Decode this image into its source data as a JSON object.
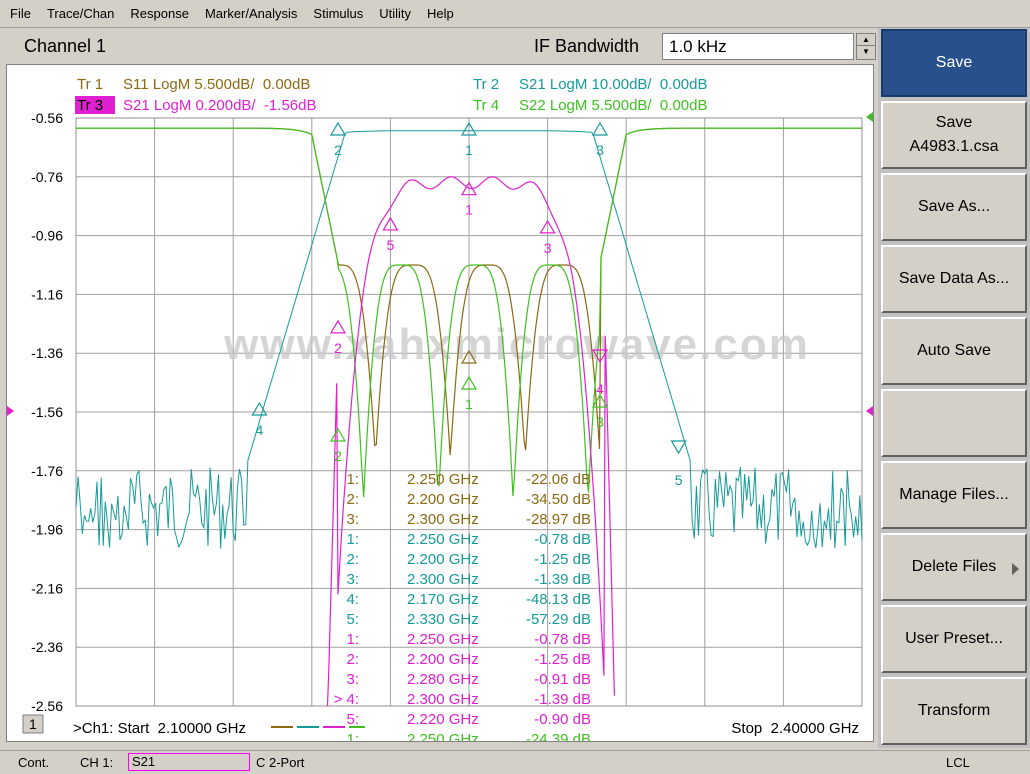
{
  "menu": [
    "File",
    "Trace/Chan",
    "Response",
    "Marker/Analysis",
    "Stimulus",
    "Utility",
    "Help"
  ],
  "channel": {
    "title": "Channel 1",
    "ifbw_label": "IF Bandwidth",
    "ifbw_value": "1.0 kHz"
  },
  "traces": [
    {
      "label": "Tr 1",
      "text": "S11 LogM 5.500dB/  0.00dB",
      "color": "#8b6a14"
    },
    {
      "label": "Tr 2",
      "text": "S21 LogM 10.00dB/  0.00dB",
      "color": "#169a9a"
    },
    {
      "label": "Tr 3",
      "text": "S21 LogM 0.200dB/  -1.56dB",
      "color": "#e020d0"
    },
    {
      "label": "Tr 4",
      "text": "S22 LogM 5.500dB/  0.00dB",
      "color": "#40c020"
    }
  ],
  "y_ticks": [
    "-0.56",
    "-0.76",
    "-0.96",
    "-1.16",
    "-1.36",
    "-1.56",
    "-1.76",
    "-1.96",
    "-2.16",
    "-2.36",
    "-2.56"
  ],
  "watermark": "www.xahxmicrowave.com",
  "marker_table": [
    {
      "id": "1:",
      "freq": "2.250 GHz",
      "value": "-22.06 dB",
      "color": "#8b6a14"
    },
    {
      "id": "2:",
      "freq": "2.200 GHz",
      "value": "-34.50 dB",
      "color": "#8b6a14"
    },
    {
      "id": "3:",
      "freq": "2.300 GHz",
      "value": "-28.97 dB",
      "color": "#8b6a14"
    },
    {
      "id": "1:",
      "freq": "2.250 GHz",
      "value": "-0.78 dB",
      "color": "#169a9a"
    },
    {
      "id": "2:",
      "freq": "2.200 GHz",
      "value": "-1.25 dB",
      "color": "#169a9a"
    },
    {
      "id": "3:",
      "freq": "2.300 GHz",
      "value": "-1.39 dB",
      "color": "#169a9a"
    },
    {
      "id": "4:",
      "freq": "2.170 GHz",
      "value": "-48.13 dB",
      "color": "#169a9a"
    },
    {
      "id": "5:",
      "freq": "2.330 GHz",
      "value": "-57.29 dB",
      "color": "#169a9a"
    },
    {
      "id": "1:",
      "freq": "2.250 GHz",
      "value": "-0.78 dB",
      "color": "#e020d0"
    },
    {
      "id": "2:",
      "freq": "2.200 GHz",
      "value": "-1.25 dB",
      "color": "#e020d0"
    },
    {
      "id": "3:",
      "freq": "2.280 GHz",
      "value": "-0.91 dB",
      "color": "#e020d0"
    },
    {
      "id": "> 4:",
      "freq": "2.300 GHz",
      "value": "-1.39 dB",
      "color": "#e020d0"
    },
    {
      "id": "5:",
      "freq": "2.220 GHz",
      "value": "-0.90 dB",
      "color": "#e020d0"
    },
    {
      "id": "1:",
      "freq": "2.250 GHz",
      "value": "-24.39 dB",
      "color": "#40c020"
    }
  ],
  "footer": {
    "badge": "1",
    "start": ">Ch1: Start  2.10000 GHz",
    "stop": "Stop  2.40000 GHz"
  },
  "softkeys": [
    {
      "label": "Save",
      "sub": "",
      "active": true
    },
    {
      "label": "Save",
      "sub": "A4983.1.csa",
      "active": false
    },
    {
      "label": "Save As...",
      "sub": "",
      "active": false
    },
    {
      "label": "Save Data As...",
      "sub": "",
      "active": false
    },
    {
      "label": "Auto Save",
      "sub": "",
      "active": false
    },
    {
      "label": "",
      "sub": "",
      "active": false
    },
    {
      "label": "Manage Files...",
      "sub": "",
      "active": false
    },
    {
      "label": "Delete Files",
      "sub": "",
      "active": false
    },
    {
      "label": "User Preset...",
      "sub": "",
      "active": false
    },
    {
      "label": "Transform",
      "sub": "",
      "active": false
    }
  ],
  "status": {
    "mode": "Cont.",
    "channel": "CH 1:",
    "param": "S21",
    "port": "C  2-Port",
    "remote": "LCL"
  },
  "chart_data": {
    "type": "line",
    "xlabel": "",
    "ylabel": "",
    "x_range_ghz": [
      2.1,
      2.4
    ],
    "reference_level_tr3": -1.56,
    "scale_tr3_db_per_div": 0.2,
    "markers": {
      "Tr1": [
        [
          2.25,
          -22.06
        ],
        [
          2.2,
          -34.5
        ],
        [
          2.3,
          -28.97
        ]
      ],
      "Tr2": [
        [
          2.25,
          -0.78
        ],
        [
          2.2,
          -1.25
        ],
        [
          2.3,
          -1.39
        ],
        [
          2.17,
          -48.13
        ],
        [
          2.33,
          -57.29
        ]
      ],
      "Tr3": [
        [
          2.25,
          -0.78
        ],
        [
          2.2,
          -1.25
        ],
        [
          2.28,
          -0.91
        ],
        [
          2.3,
          -1.39
        ],
        [
          2.22,
          -0.9
        ]
      ],
      "Tr4": [
        [
          2.25,
          -24.39
        ]
      ]
    }
  }
}
